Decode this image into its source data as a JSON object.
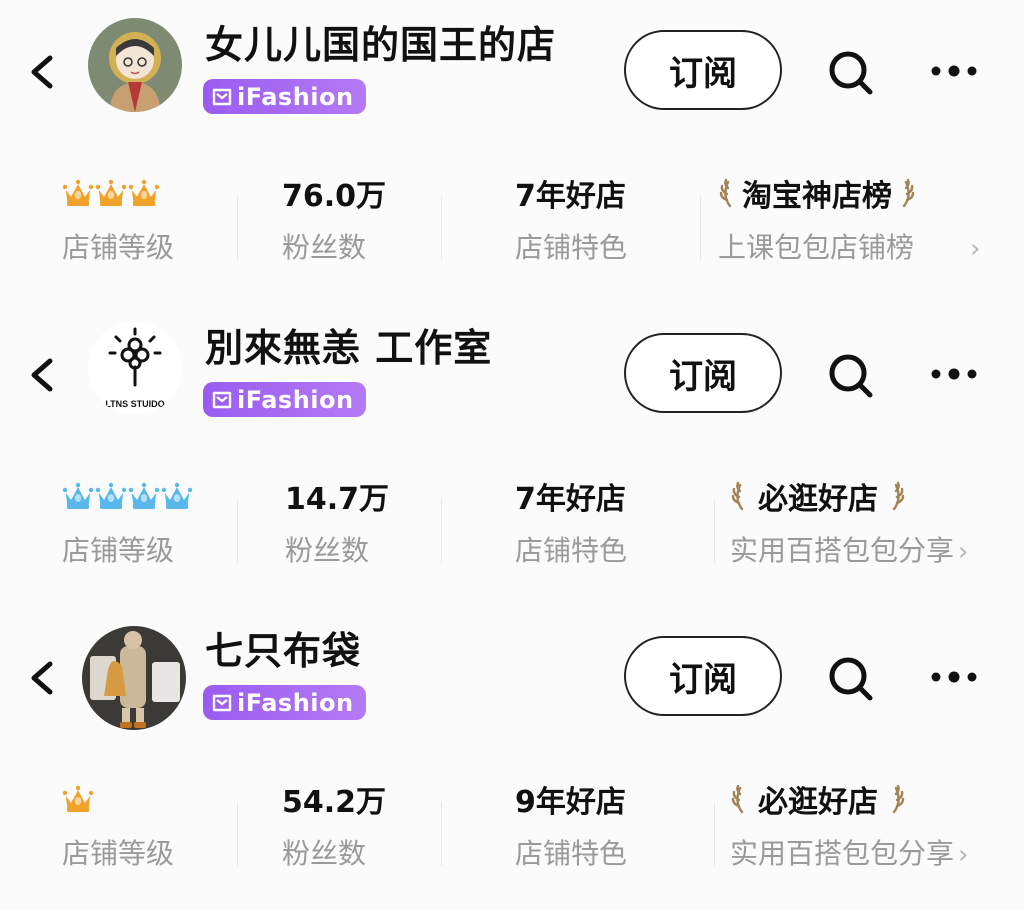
{
  "shops": [
    {
      "name": "女儿儿国的国王的店",
      "badge": "iFashion",
      "subscribe": "订阅",
      "crowns": 3,
      "crown_color": "#f0a22a",
      "level_label": "店铺等级",
      "fans_value": "76.0万",
      "fans_label": "粉丝数",
      "feature_value": "7年好店",
      "feature_label": "店铺特色",
      "ranking_title": "淘宝神店榜",
      "ranking_sub": "上课包包店铺榜",
      "avatar_icon": "illustrated-girl-avatar"
    },
    {
      "name": "別來無恙 工作室",
      "badge": "iFashion",
      "subscribe": "订阅",
      "crowns": 4,
      "crown_color": "#59b8ea",
      "level_label": "店铺等级",
      "fans_value": "14.7万",
      "fans_label": "粉丝数",
      "feature_value": "7年好店",
      "feature_label": "店铺特色",
      "ranking_title": "必逛好店",
      "ranking_sub": "实用百搭包包分享",
      "avatar_icon": "studio-flower-logo",
      "avatar_text": "LTNS STUIDO"
    },
    {
      "name": "七只布袋",
      "badge": "iFashion",
      "subscribe": "订阅",
      "crowns": 1,
      "crown_color": "#f0a22a",
      "level_label": "店铺等级",
      "fans_value": "54.2万",
      "fans_label": "粉丝数",
      "feature_value": "9年好店",
      "feature_label": "店铺特色",
      "ranking_title": "必逛好店",
      "ranking_sub": "实用百搭包包分享",
      "avatar_icon": "person-with-bag-photo"
    }
  ],
  "chevron": "›",
  "colors": {
    "badge": "#a066f2",
    "gold_text": "#a38355",
    "label_gray": "#9a9a9a"
  }
}
